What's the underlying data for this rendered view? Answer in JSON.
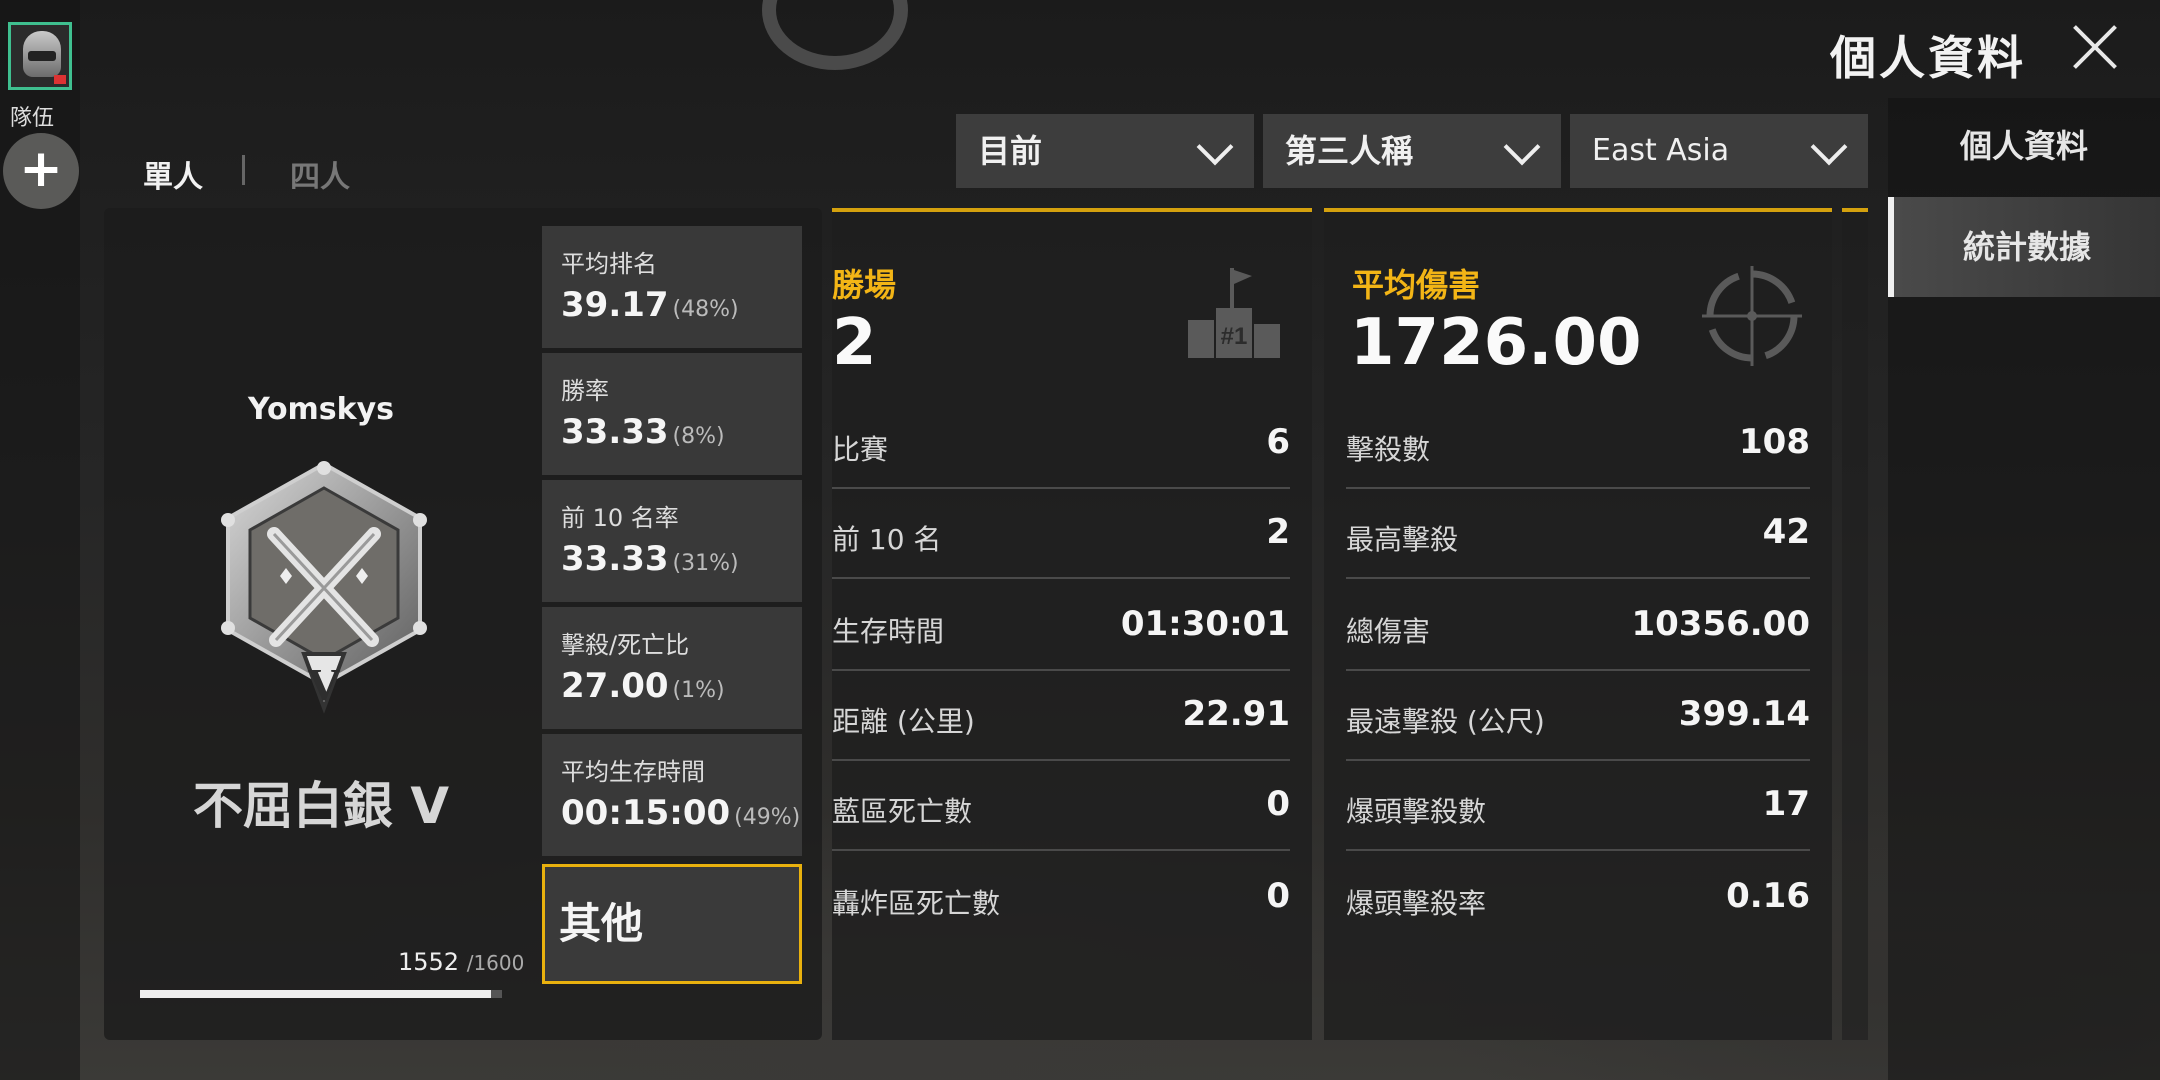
{
  "rail": {
    "team_label": "隊伍",
    "add_label": "+"
  },
  "header": {
    "title": "個人資料"
  },
  "side_tabs": [
    "個人資料",
    "統計數據"
  ],
  "modes": [
    "單人",
    "四人"
  ],
  "filters": {
    "season": "目前",
    "perspective": "第三人稱",
    "region": "East Asia"
  },
  "profile": {
    "player_name": "Yomskys",
    "rank_name": "不屈白銀 V",
    "rank_numeral": "V",
    "rank_points": "1552",
    "rank_points_max": "/1600",
    "rank_progress": 0.97
  },
  "summary_tiles": [
    {
      "label": "平均排名",
      "value": "39.17",
      "pct": "(48%)"
    },
    {
      "label": "勝率",
      "value": "33.33",
      "pct": "(8%)"
    },
    {
      "label": "前 10 名率",
      "value": "33.33",
      "pct": "(31%)"
    },
    {
      "label": "擊殺/死亡比",
      "value": "27.00",
      "pct": "(1%)"
    },
    {
      "label": "平均生存時間",
      "value": "00:15:00",
      "pct": "(49%)"
    }
  ],
  "other_tile": "其他",
  "wins_panel": {
    "heading": "勝場",
    "value": "2",
    "icon_label": "#1",
    "rows": [
      {
        "label": "比賽",
        "value": "6"
      },
      {
        "label": "前 10 名",
        "value": "2"
      },
      {
        "label": "生存時間",
        "value": "01:30:01"
      },
      {
        "label": "距離 (公里)",
        "value": "22.91"
      },
      {
        "label": "藍區死亡數",
        "value": "0"
      },
      {
        "label": "轟炸區死亡數",
        "value": "0"
      }
    ]
  },
  "damage_panel": {
    "heading": "平均傷害",
    "value": "1726.00",
    "rows": [
      {
        "label": "擊殺數",
        "value": "108"
      },
      {
        "label": "最高擊殺",
        "value": "42"
      },
      {
        "label": "總傷害",
        "value": "10356.00"
      },
      {
        "label": "最遠擊殺 (公尺)",
        "value": "399.14"
      },
      {
        "label": "爆頭擊殺數",
        "value": "17"
      },
      {
        "label": "爆頭擊殺率",
        "value": "0.16"
      }
    ]
  },
  "colors": {
    "accent": "#f3b516",
    "tab_active_border": "#f0f0f0",
    "avatar_border": "#3fbf8f"
  }
}
